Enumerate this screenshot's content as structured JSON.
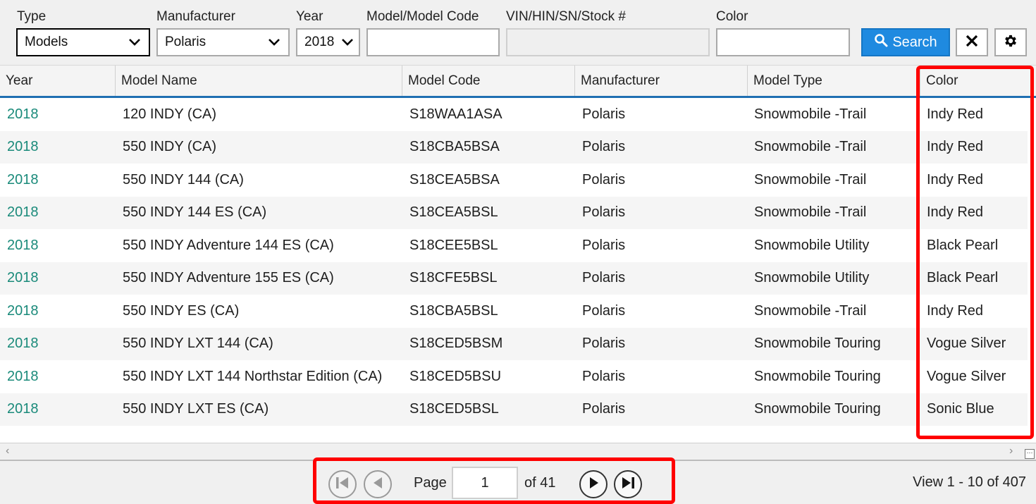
{
  "filters": {
    "type": {
      "label": "Type",
      "value": "Models"
    },
    "manufacturer": {
      "label": "Manufacturer",
      "value": "Polaris"
    },
    "year": {
      "label": "Year",
      "value": "2018"
    },
    "model_code": {
      "label": "Model/Model Code",
      "value": ""
    },
    "vin": {
      "label": "VIN/HIN/SN/Stock #",
      "value": ""
    },
    "color": {
      "label": "Color",
      "value": ""
    },
    "search_label": "Search"
  },
  "table": {
    "columns": [
      "Year",
      "Model Name",
      "Model Code",
      "Manufacturer",
      "Model Type",
      "Color"
    ],
    "rows": [
      [
        "2018",
        "120 INDY (CA)",
        "S18WAA1ASA",
        "Polaris",
        "Snowmobile -Trail",
        "Indy Red"
      ],
      [
        "2018",
        "550 INDY (CA)",
        "S18CBA5BSA",
        "Polaris",
        "Snowmobile -Trail",
        "Indy Red"
      ],
      [
        "2018",
        "550 INDY 144 (CA)",
        "S18CEA5BSA",
        "Polaris",
        "Snowmobile -Trail",
        "Indy Red"
      ],
      [
        "2018",
        "550 INDY 144 ES (CA)",
        "S18CEA5BSL",
        "Polaris",
        "Snowmobile -Trail",
        "Indy Red"
      ],
      [
        "2018",
        "550 INDY Adventure 144 ES (CA)",
        "S18CEE5BSL",
        "Polaris",
        "Snowmobile Utility",
        "Black Pearl"
      ],
      [
        "2018",
        "550 INDY Adventure 155 ES (CA)",
        "S18CFE5BSL",
        "Polaris",
        "Snowmobile Utility",
        "Black Pearl"
      ],
      [
        "2018",
        "550 INDY ES (CA)",
        "S18CBA5BSL",
        "Polaris",
        "Snowmobile -Trail",
        "Indy Red"
      ],
      [
        "2018",
        "550 INDY LXT 144 (CA)",
        "S18CED5BSM",
        "Polaris",
        "Snowmobile Touring",
        "Vogue Silver"
      ],
      [
        "2018",
        "550 INDY LXT 144 Northstar Edition (CA)",
        "S18CED5BSU",
        "Polaris",
        "Snowmobile Touring",
        "Vogue Silver"
      ],
      [
        "2018",
        "550 INDY LXT ES (CA)",
        "S18CED5BSL",
        "Polaris",
        "Snowmobile Touring",
        "Sonic Blue"
      ]
    ]
  },
  "pager": {
    "page_label": "Page",
    "page_value": "1",
    "of_label": "of 41",
    "view_info": "View 1 - 10 of 407"
  },
  "colors": {
    "accent": "#1f8ae0",
    "year_link": "#1a8a7a",
    "header_rule": "#1f6fb2",
    "annotation": "#ff0000"
  },
  "icons": {
    "search": "search-icon",
    "clear": "close-icon",
    "settings": "gear-icon",
    "dropdown": "chevron-down-icon",
    "first": "first-page-icon",
    "prev": "prev-page-icon",
    "next": "next-page-icon",
    "last": "last-page-icon"
  }
}
